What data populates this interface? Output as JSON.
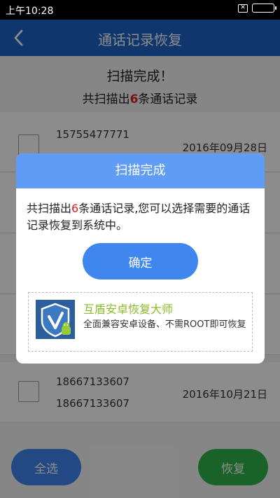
{
  "status_bar": {
    "time": "上午10:28",
    "sim_label": "✕"
  },
  "header": {
    "title": "通话记录恢复"
  },
  "scan_summary": {
    "done": "扫描完成！",
    "count_prefix": "共扫描出",
    "count": "6",
    "count_suffix": "条通话记录"
  },
  "records": [
    {
      "phone": "15755477771",
      "date": "2016年09月28日"
    },
    {
      "phone": "",
      "date": ""
    },
    {
      "phone": "",
      "date": ""
    },
    {
      "phone": "",
      "date": ""
    },
    {
      "phone": "18667133607",
      "phone2": "18667133607",
      "date": "2016年10月21日"
    }
  ],
  "dialog": {
    "title": "扫描完成",
    "msg_prefix": "共扫描出",
    "count": "6",
    "msg_suffix": "条通话记录,您可以选择需要的通话记录恢复到系统中。",
    "confirm_label": "确定",
    "promo_title": "互盾安卓恢复大师",
    "promo_desc": "全面兼容安卓设备、不需ROOT即可恢复"
  },
  "bottom_bar": {
    "select_all_label": "全选",
    "restore_label": "恢复"
  },
  "colors": {
    "header": "#1d63c6",
    "dialog_header": "#5e9cf6",
    "primary_button": "#3f86ee",
    "restore_button": "#2fb34a",
    "count_red": "#d9231c",
    "promo_green": "#8cbc28"
  }
}
